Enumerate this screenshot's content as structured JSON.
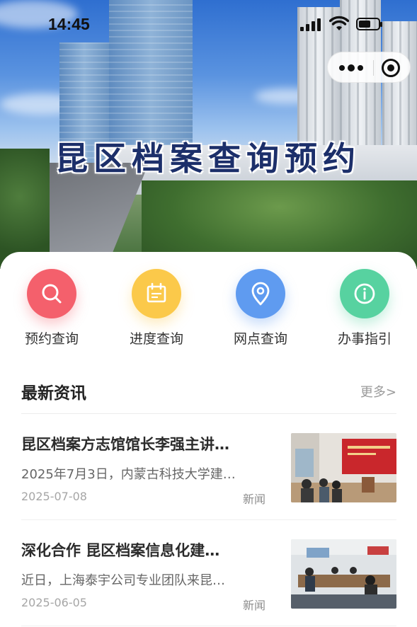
{
  "status_bar": {
    "time": "14:45"
  },
  "hero": {
    "title": "昆区档案查询预约"
  },
  "quick_actions": [
    {
      "label": "预约查询",
      "icon": "search-icon",
      "color": "#f4606c"
    },
    {
      "label": "进度查询",
      "icon": "calendar-icon",
      "color": "#fbc94a"
    },
    {
      "label": "网点查询",
      "icon": "location-pin-icon",
      "color": "#5f9bf0"
    },
    {
      "label": "办事指引",
      "icon": "info-icon",
      "color": "#57d2a0"
    }
  ],
  "news": {
    "heading": "最新资讯",
    "more_label": "更多>",
    "items": [
      {
        "title": "昆区档案方志馆馆长李强主讲…",
        "summary": "2025年7月3日，内蒙古科技大学建…",
        "date": "2025-07-08",
        "tag": "新闻",
        "thumbnail": "meeting-room-photo"
      },
      {
        "title": "深化合作 昆区档案信息化建…",
        "summary": "近日，上海泰宇公司专业团队来昆…",
        "date": "2025-06-05",
        "tag": "新闻",
        "thumbnail": "conference-photo"
      }
    ]
  }
}
